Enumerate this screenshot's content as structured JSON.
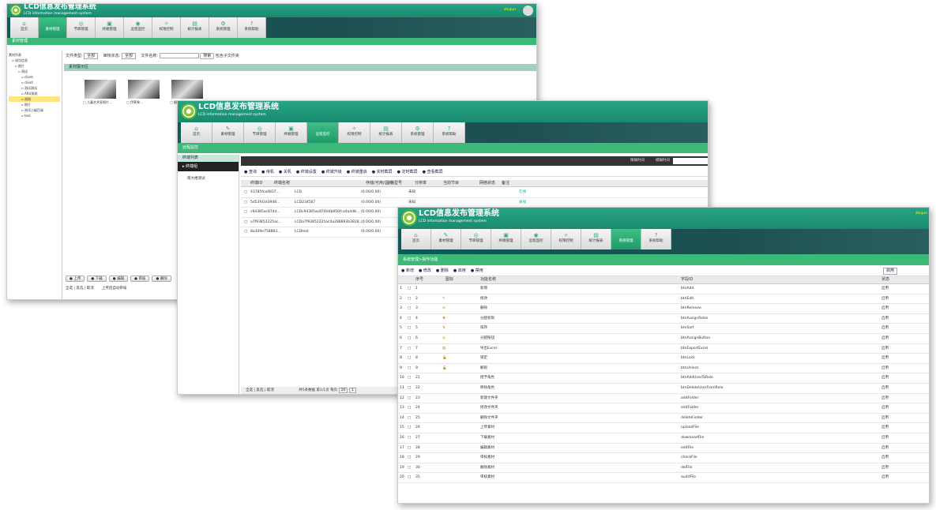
{
  "app": {
    "title": "LCD信息发布管理系统",
    "subtitle": "LCD information management system",
    "user": "zhujun"
  },
  "nav": [
    "首页",
    "素材管理",
    "节目管理",
    "终端管理",
    "远程监控",
    "权限控制",
    "统计报表",
    "系统管理",
    "系统帮助"
  ],
  "w1": {
    "breadcrumb": "素材管理",
    "filter": {
      "type_label": "文件类型:",
      "type_val": "全部",
      "audit_label": "审核状态:",
      "audit_val": "全部",
      "name_label": "文件名称:",
      "search": "搜索",
      "include_sub": "包含子文件夹"
    },
    "panel": "素材展示区",
    "tree": [
      "素材列表",
      "成功信息",
      "图片",
      "测试",
      "client",
      "client",
      "测试测试",
      "ARU测测",
      "测测",
      "图片",
      "测试二级目录",
      "test"
    ],
    "thumbs": [
      "儿童艺术家照片...",
      "伊莱果...",
      "摄影师..."
    ],
    "buttons": [
      "上传",
      "下载",
      "编辑",
      "审核",
      "删除"
    ],
    "foot1": "全选 | 反选 | 取消",
    "foot2": "上传后自动审核"
  },
  "w2": {
    "breadcrumb": "远程监控",
    "side_title": "终端列表",
    "group": "终端组",
    "sub": "南大楼测试",
    "search_opts": [
      "精确时间",
      "模糊时间"
    ],
    "tools": [
      "查询",
      "待机",
      "关机",
      "终端设置",
      "终端升级",
      "终端重启",
      "实时截屏",
      "定时截屏",
      "查看截屏"
    ],
    "cols": [
      "终端ID",
      "终端名称",
      "存储(可用/总共)",
      "主板型号",
      "分辨率",
      "当前节目",
      "网络状态",
      "备注"
    ],
    "rows": [
      [
        "43785fca4837...",
        "LCD",
        "(0.00/0.00)",
        "未知",
        "在线"
      ],
      [
        "5d53fd3d3948...",
        "LCD234567",
        "(0.00/0.00)",
        "未知",
        "离线"
      ],
      [
        "c9d385ac874d...",
        "LCDc94385ac874d4b856fca4a4d8...",
        "(0.00/0.00)",
        "",
        ""
      ],
      [
        "a7f93852225ac...",
        "LCDa7f93852225ac4a288893b3828...",
        "(0.00/0.00)",
        "",
        ""
      ],
      [
        "8a309e758883...",
        "LCDtest",
        "(0.00/0.00)",
        "",
        ""
      ]
    ],
    "pager": {
      "left": "全选 | 反选 | 取消",
      "info": "共5条数据 第1/1页 每页",
      "size": "20",
      "page": "1"
    }
  },
  "w3": {
    "breadcrumb": "系统管理>操作功能",
    "tools": [
      "新增",
      "修改",
      "删除",
      "启用",
      "禁用"
    ],
    "filter": "启用",
    "cols": [
      "序号",
      "图标",
      "功能名称",
      "字段ID",
      "状态"
    ],
    "rows": [
      [
        "1",
        "1",
        "",
        "新增",
        "btnAdd",
        "启用"
      ],
      [
        "2",
        "2",
        "✎",
        "修改",
        "btnEdit",
        "启用"
      ],
      [
        "3",
        "3",
        "⊘",
        "删除",
        "btnRemove",
        "启用"
      ],
      [
        "4",
        "4",
        "♣",
        "分配权限",
        "btnAssignRoles",
        "启用"
      ],
      [
        "5",
        "5",
        "⇅",
        "排序",
        "btnSort",
        "启用"
      ],
      [
        "6",
        "6",
        "◎",
        "分配按钮",
        "btnAssignButton",
        "启用"
      ],
      [
        "7",
        "7",
        "▤",
        "导出Excel",
        "btnExportExcel",
        "启用"
      ],
      [
        "8",
        "8",
        "🔒",
        "锁定",
        "btnLock",
        "启用"
      ],
      [
        "9",
        "9",
        "🔓",
        "解锁",
        "btnUnlock",
        "启用"
      ],
      [
        "10",
        "21",
        "",
        "授予角色",
        "btnAddUserToRole",
        "启用"
      ],
      [
        "11",
        "22",
        "",
        "移除角色",
        "btnDeleteUserFromRole",
        "启用"
      ],
      [
        "12",
        "23",
        "",
        "新建文件夹",
        "addFolder",
        "启用"
      ],
      [
        "13",
        "24",
        "",
        "修改文件夹",
        "editFolder",
        "启用"
      ],
      [
        "14",
        "25",
        "",
        "删除文件夹",
        "deleteFolder",
        "启用"
      ],
      [
        "15",
        "26",
        "",
        "上传素材",
        "uploadFile",
        "启用"
      ],
      [
        "16",
        "27",
        "",
        "下载素材",
        "downloadFile",
        "启用"
      ],
      [
        "17",
        "28",
        "",
        "编辑素材",
        "editFile",
        "启用"
      ],
      [
        "18",
        "29",
        "",
        "审核素材",
        "checkFile",
        "启用"
      ],
      [
        "19",
        "30",
        "",
        "删除素材",
        "delFile",
        "启用"
      ],
      [
        "20",
        "31",
        "",
        "审核素材",
        "auditFile",
        "启用"
      ]
    ]
  }
}
